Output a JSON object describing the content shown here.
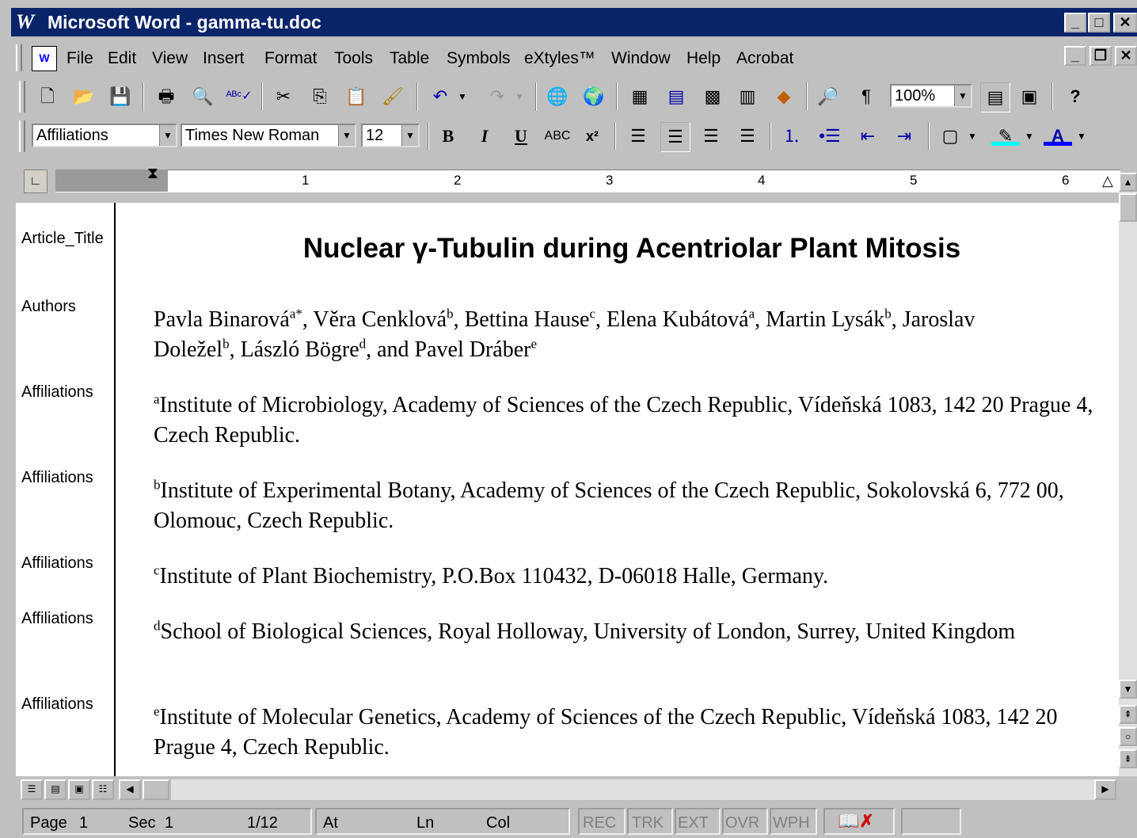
{
  "window": {
    "app_title": "Microsoft Word - gamma-tu.doc"
  },
  "menu": {
    "items": [
      "File",
      "Edit",
      "View",
      "Insert",
      "Format",
      "Tools",
      "Table",
      "Symbols",
      "eXtyles™",
      "Window",
      "Help",
      "Acrobat"
    ]
  },
  "format_toolbar": {
    "style": "Affiliations",
    "font": "Times New Roman",
    "size": "12",
    "bold": "B",
    "italic": "I",
    "underline": "U",
    "smallcaps": "ABC",
    "superscript": "x²"
  },
  "standard_toolbar": {
    "zoom": "100%"
  },
  "ruler": {
    "numbers": [
      "1",
      "2",
      "3",
      "4",
      "5",
      "6"
    ]
  },
  "styles": {
    "title": "Article_Title",
    "authors": "Authors",
    "affiliations": "Affiliations"
  },
  "document": {
    "title": "Nuclear γ-Tubulin during Acentriolar Plant Mitosis",
    "authors_line1_a": "Pavla Binarová",
    "authors_sup1": "a*",
    "authors_b": ", Věra Cenklová",
    "authors_sup2": "b",
    "authors_c": ", Bettina Hause",
    "authors_sup3": "c",
    "authors_d": ", Elena Kubátová",
    "authors_sup4": "a",
    "authors_e": ", Martin Lysák",
    "authors_sup5": "b",
    "authors_f": ", Jaroslav",
    "authors_line2_a": "Doležel",
    "authors_sup6": "b",
    "authors_g": ", László Bögre",
    "authors_sup7": "d",
    "authors_h": ", and Pavel Dráber",
    "authors_sup8": "e",
    "aff_a_sup": "a",
    "aff_a": "Institute of Microbiology, Academy of Sciences of the Czech Republic, Vídeňská 1083, 142 20 Prague 4, Czech Republic.",
    "aff_b_sup": "b",
    "aff_b": "Institute of Experimental Botany, Academy of Sciences of the Czech Republic, Sokolovská 6, 772 00, Olomouc, Czech Republic.",
    "aff_c_sup": "c",
    "aff_c": "Institute of Plant Biochemistry, P.O.Box 110432, D-06018 Halle, Germany.",
    "aff_d_sup": "d",
    "aff_d": "School of Biological Sciences, Royal Holloway, University of London, Surrey, United Kingdom",
    "aff_e_sup": "e",
    "aff_e": "Institute of Molecular Genetics, Academy of Sciences of the Czech Republic, Vídeňská 1083, 142 20 Prague 4, Czech Republic."
  },
  "status": {
    "page": "Page",
    "page_num": "1",
    "sec": "Sec",
    "sec_num": "1",
    "pages": "1/12",
    "at": "At",
    "ln": "Ln",
    "col": "Col",
    "rec": "REC",
    "trk": "TRK",
    "ext": "EXT",
    "ovr": "OVR",
    "wph": "WPH"
  }
}
